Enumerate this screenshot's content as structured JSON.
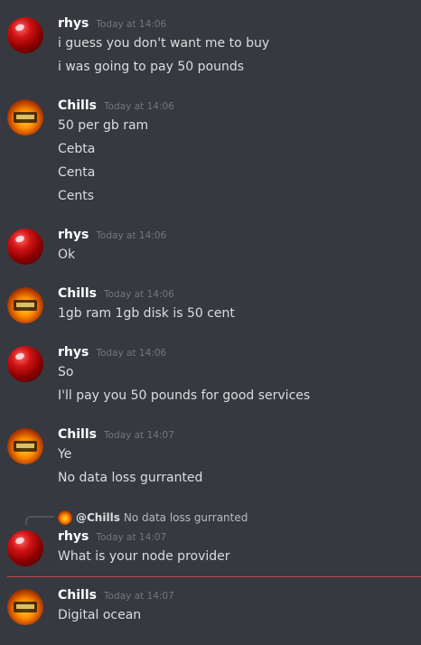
{
  "messages": [
    {
      "author": "rhys",
      "timestamp": "Today at 14:06",
      "lines": [
        "i guess you don't want me to buy",
        "i was going to pay 50 pounds"
      ]
    },
    {
      "author": "Chills",
      "timestamp": "Today at 14:06",
      "lines": [
        "50 per gb ram",
        "Cebta",
        "Centa",
        "Cents"
      ]
    },
    {
      "author": "rhys",
      "timestamp": "Today at 14:06",
      "lines": [
        "Ok"
      ]
    },
    {
      "author": "Chills",
      "timestamp": "Today at 14:06",
      "lines": [
        "1gb ram 1gb disk is 50 cent"
      ]
    },
    {
      "author": "rhys",
      "timestamp": "Today at 14:06",
      "lines": [
        "So",
        "I'll pay you 50 pounds for good services"
      ]
    },
    {
      "author": "Chills",
      "timestamp": "Today at 14:07",
      "lines": [
        "Ye",
        "No data loss gurranted"
      ]
    },
    {
      "author": "rhys",
      "timestamp": "Today at 14:07",
      "lines": [
        "What is your node provider"
      ]
    },
    {
      "author": "Chills",
      "timestamp": "Today at 14:07",
      "lines": [
        "Digital ocean"
      ]
    }
  ],
  "reply": {
    "mention": "@Chills",
    "text": "No data loss gurranted"
  },
  "colors": {
    "background": "#36393f",
    "username": "#ffffff",
    "timestamp": "#72767d",
    "text": "#dcddde",
    "new_divider": "#c8484a"
  },
  "icons": {
    "rhys_avatar": "red-sphere-avatar",
    "chills_avatar": "flame-avatar"
  }
}
